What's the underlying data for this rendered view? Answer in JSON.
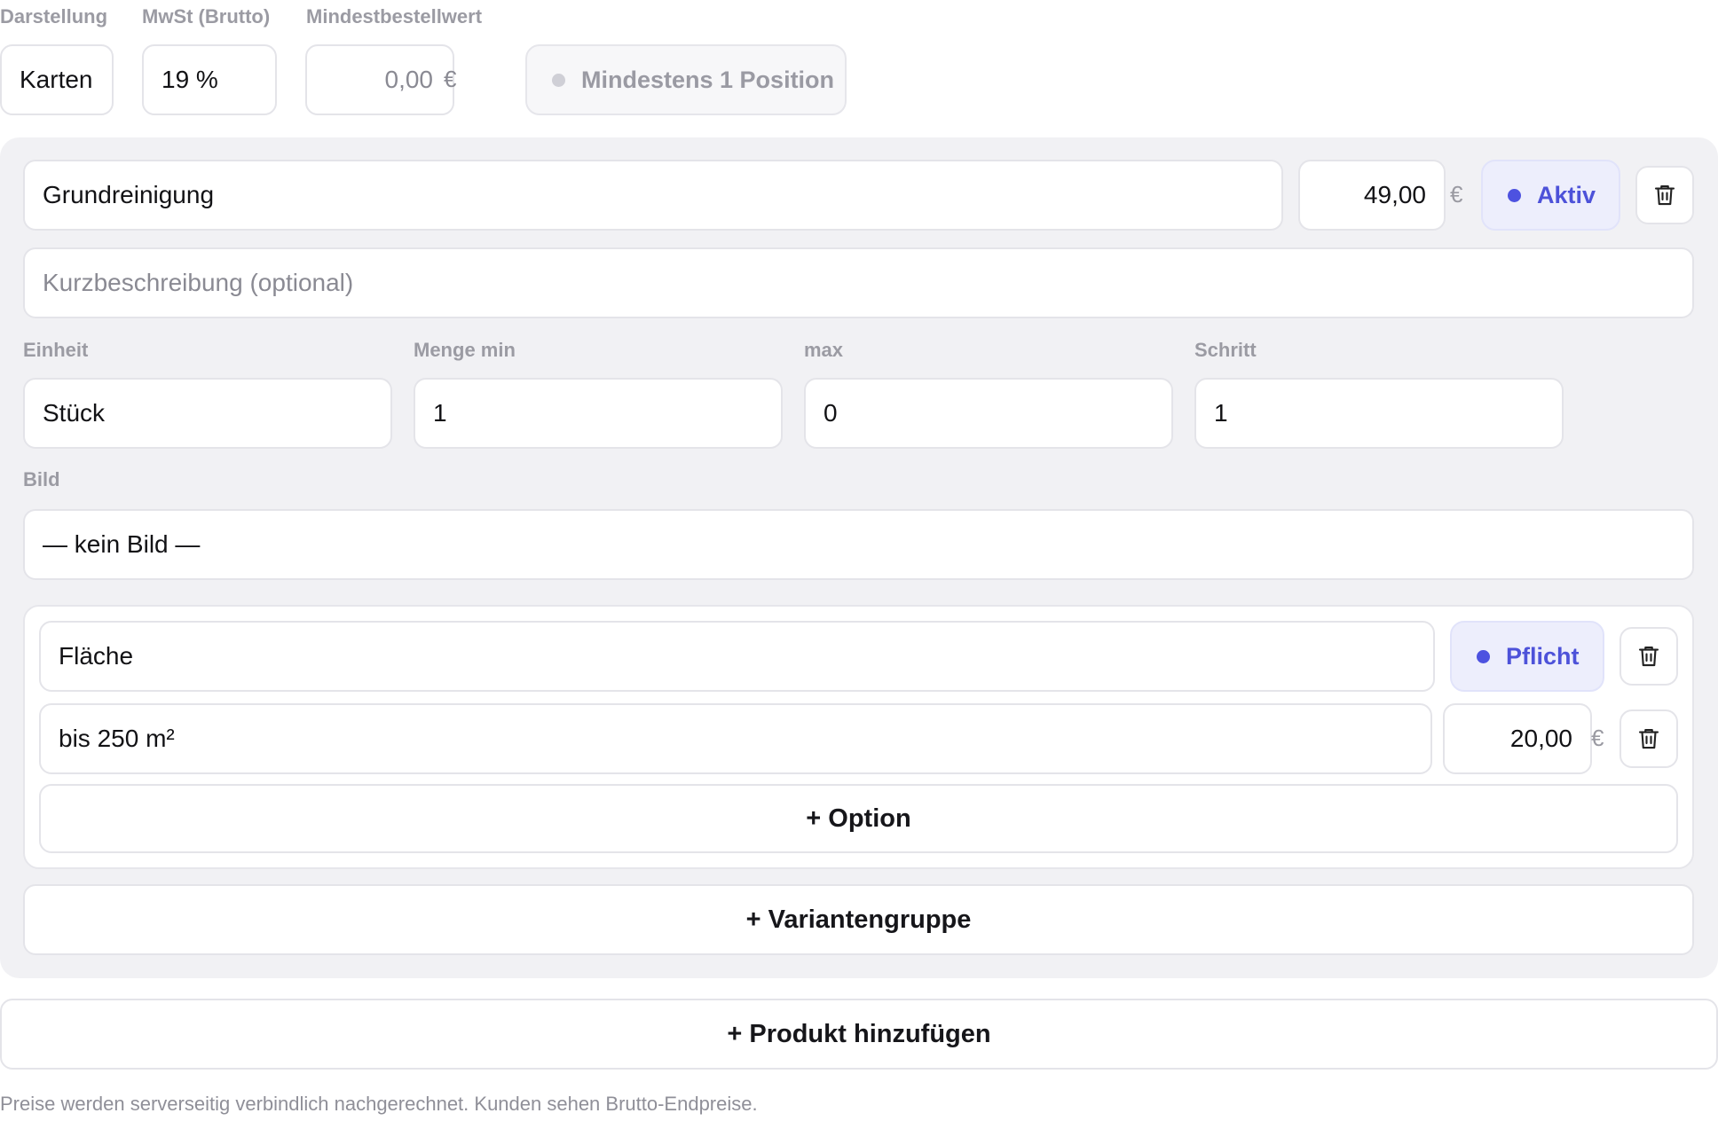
{
  "settings": {
    "display_label": "Darstellung",
    "display_value": "Karten",
    "vat_label": "MwSt (Brutto)",
    "vat_value": "19 %",
    "min_order_label": "Mindestbestellwert",
    "min_order_value": "0,00",
    "currency": "€",
    "min_position_toggle": "Mindestens 1 Position"
  },
  "product": {
    "name": "Grundreinigung",
    "price": "49,00",
    "currency": "€",
    "status": "Aktiv",
    "description_placeholder": "Kurzbeschreibung (optional)",
    "unit_label": "Einheit",
    "unit_value": "Stück",
    "qty_min_label": "Menge min",
    "qty_min_value": "1",
    "qty_max_label": "max",
    "qty_max_value": "0",
    "step_label": "Schritt",
    "step_value": "1",
    "image_label": "Bild",
    "image_value": "— kein Bild —",
    "variant_group": {
      "name": "Fläche",
      "required_label": "Pflicht",
      "options": [
        {
          "name": "bis 250 m²",
          "price": "20,00",
          "currency": "€"
        }
      ],
      "add_option_label": "+ Option"
    },
    "add_variant_group_label": "+ Variantengruppe"
  },
  "add_product_label": "+ Produkt hinzufügen",
  "footer_note": "Preise werden serverseitig verbindlich nachgerechnet. Kunden sehen Brutto-Endpreise.",
  "colors": {
    "accent": "#4d52e0",
    "panel_bg": "#f1f1f4",
    "border": "#e4e4e9",
    "muted_text": "#9b9ba3"
  },
  "icons": {
    "delete": "trash-icon",
    "status_dot": "dot-icon"
  }
}
